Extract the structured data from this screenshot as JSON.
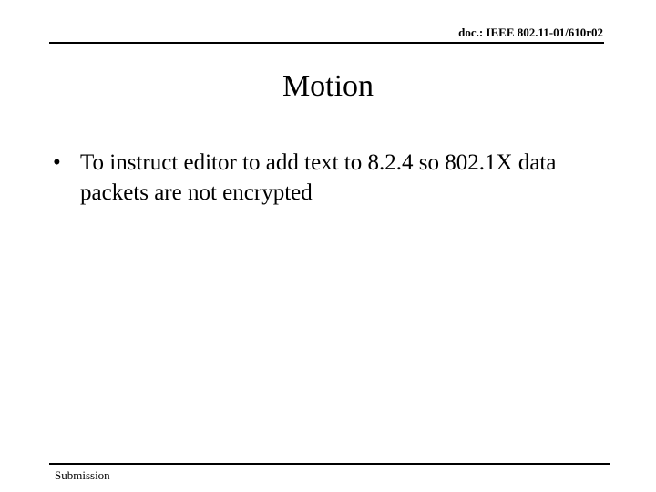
{
  "header": {
    "doc_id": "doc.: IEEE 802.11-01/610r02"
  },
  "slide": {
    "title": "Motion",
    "bullets": [
      {
        "marker": "•",
        "text": "To instruct editor to add text to 8.2.4 so 802.1X data packets are not encrypted"
      }
    ]
  },
  "footer": {
    "left": "Submission"
  }
}
